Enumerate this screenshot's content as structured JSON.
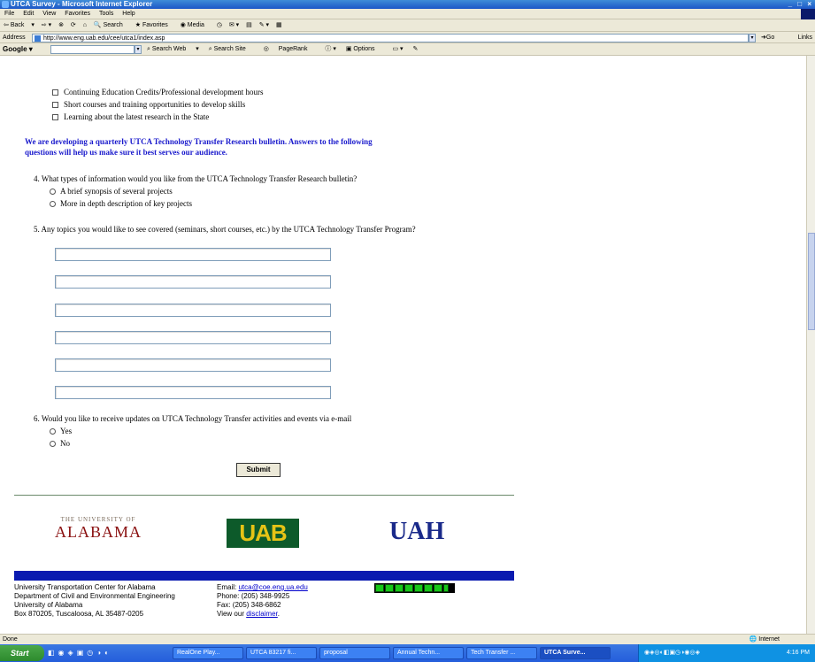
{
  "window": {
    "title": "UTCA Survey - Microsoft Internet Explorer",
    "controls": "_ □ ×"
  },
  "menu": [
    "File",
    "Edit",
    "View",
    "Favorites",
    "Tools",
    "Help"
  ],
  "toolbar": {
    "back": "Back",
    "search": "Search",
    "favorites": "Favorites",
    "media": "Media"
  },
  "address": {
    "label": "Address",
    "url": "http://www.eng.uab.edu/cee/utca1/index.asp",
    "go": "Go",
    "links": "Links"
  },
  "google": {
    "logo": "Google",
    "search_web": "Search Web",
    "search_site": "Search Site",
    "pagerank": "PageRank",
    "options": "Options"
  },
  "form": {
    "checkbox_items": [
      "Continuing Education Credits/Professional development hours",
      "Short courses and training opportunities to develop skills",
      "Learning about the latest research in the State"
    ],
    "announcement_line1": "We are developing a quarterly UTCA Technology Transfer Research bulletin.  Answers to the following",
    "announcement_line2": "questions will help us make sure it best serves our audience.",
    "q4": "4. What types of information would you like from the UTCA Technology Transfer Research bulletin?",
    "q4_options": [
      "A brief synopsis of several projects",
      "More in depth description of key projects"
    ],
    "q5": "5. Any topics you would like to see covered (seminars, short courses, etc.) by the UTCA Technology Transfer Program?",
    "q6": "6. Would you like to receive updates on UTCA Technology Transfer activities and events via e-mail",
    "q6_options": [
      "Yes",
      "No"
    ],
    "submit": "Submit"
  },
  "logos": {
    "ua_line1": "THE UNIVERSITY OF",
    "ua_line2": "ALABAMA",
    "uab": "UAB",
    "uah": "UAH"
  },
  "footer": {
    "addr1": "University Transportation Center for Alabama",
    "addr2": "Department of Civil and Environmental Engineering",
    "addr3": "University of Alabama",
    "addr4": "Box 870205, Tuscaloosa, AL 35487-0205",
    "email_label": "Email: ",
    "email": "utca@coe.eng.ua.edu",
    "phone": "Phone: (205) 348-9925",
    "fax": "Fax: (205) 348-6862",
    "view_label": "View our ",
    "disclaimer": "disclaimer",
    "view_end": "."
  },
  "status": {
    "text": "Done",
    "zone": "Internet"
  },
  "taskbar": {
    "start": "Start",
    "tasks": [
      "RealOne Play...",
      "UTCA 83217 fi...",
      "proposal",
      "Annual Techn...",
      "Tech Transfer ...",
      "UTCA Surve..."
    ],
    "clock": "4:16 PM"
  }
}
